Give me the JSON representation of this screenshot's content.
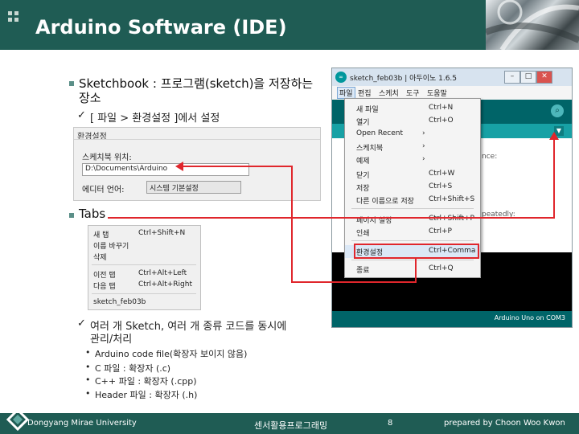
{
  "header": {
    "title": "Arduino Software (IDE)"
  },
  "section_sketchbook": {
    "heading_line1": "Sketchbook : 프로그램(sketch)을 저장하는",
    "heading_line2": "장소",
    "check_item": "[ 파일 > 환경설정 ]에서 설정"
  },
  "pref_dialog": {
    "title": "환경설정",
    "sketchbook_location_label": "스케치북 위치:",
    "sketchbook_location_value": "D:\\Documents\\Arduino",
    "editor_language_label": "에디터 언어:",
    "editor_language_value": "시스템 기본설정"
  },
  "section_tabs": {
    "heading": "Tabs",
    "check_line1": "여러 개 Sketch, 여러 개 종류 코드를 동시에",
    "check_line2": "관리/처리",
    "bullets": [
      "Arduino code file(확장자 보이지 않음)",
      "C 파일 : 확장자 (.c)",
      "C++ 파일 : 확장자 (.cpp)",
      "Header 파일 : 확장자 (.h)"
    ]
  },
  "tabs_menu": {
    "items": [
      {
        "label": "새 탭",
        "shortcut": "Ctrl+Shift+N"
      },
      {
        "label": "이름 바꾸기",
        "shortcut": ""
      },
      {
        "label": "삭제",
        "shortcut": ""
      },
      {
        "label": "이전 탭",
        "shortcut": "Ctrl+Alt+Left"
      },
      {
        "label": "다음 탭",
        "shortcut": "Ctrl+Alt+Right"
      }
    ],
    "current_tab": "sketch_feb03b"
  },
  "ide_window": {
    "title": "sketch_feb03b | 아두이노 1.6.5",
    "menu": [
      "파일",
      "편집",
      "스케치",
      "도구",
      "도움말"
    ],
    "editor_snippet": "nce:",
    "editor_snippet2": "peatedly:",
    "board_status": "Arduino Uno on COM3"
  },
  "file_menu": {
    "items": [
      {
        "label": "새 파일",
        "shortcut": "Ctrl+N"
      },
      {
        "label": "열기",
        "shortcut": "Ctrl+O"
      },
      {
        "label": "Open Recent",
        "shortcut": ""
      },
      {
        "label": "스케치북",
        "shortcut": ""
      },
      {
        "label": "예제",
        "shortcut": ""
      },
      {
        "label": "닫기",
        "shortcut": "Ctrl+W"
      },
      {
        "label": "저장",
        "shortcut": "Ctrl+S"
      },
      {
        "label": "다른 이름으로 저장",
        "shortcut": "Ctrl+Shift+S"
      },
      {
        "label": "페이지 설정",
        "shortcut": "Ctrl+Shift+P"
      },
      {
        "label": "인쇄",
        "shortcut": "Ctrl+P"
      },
      {
        "label": "환경설정",
        "shortcut": "Ctrl+Comma"
      },
      {
        "label": "종료",
        "shortcut": "Ctrl+Q"
      }
    ]
  },
  "footer": {
    "university": "Dongyang Mirae University",
    "course": "센서활용프로그래밍",
    "page": "8",
    "author": "prepared by Choon Woo Kwon"
  },
  "colors": {
    "theme": "#1f5c54",
    "annotation_red": "#e0262c",
    "arduino_teal": "#006468"
  }
}
